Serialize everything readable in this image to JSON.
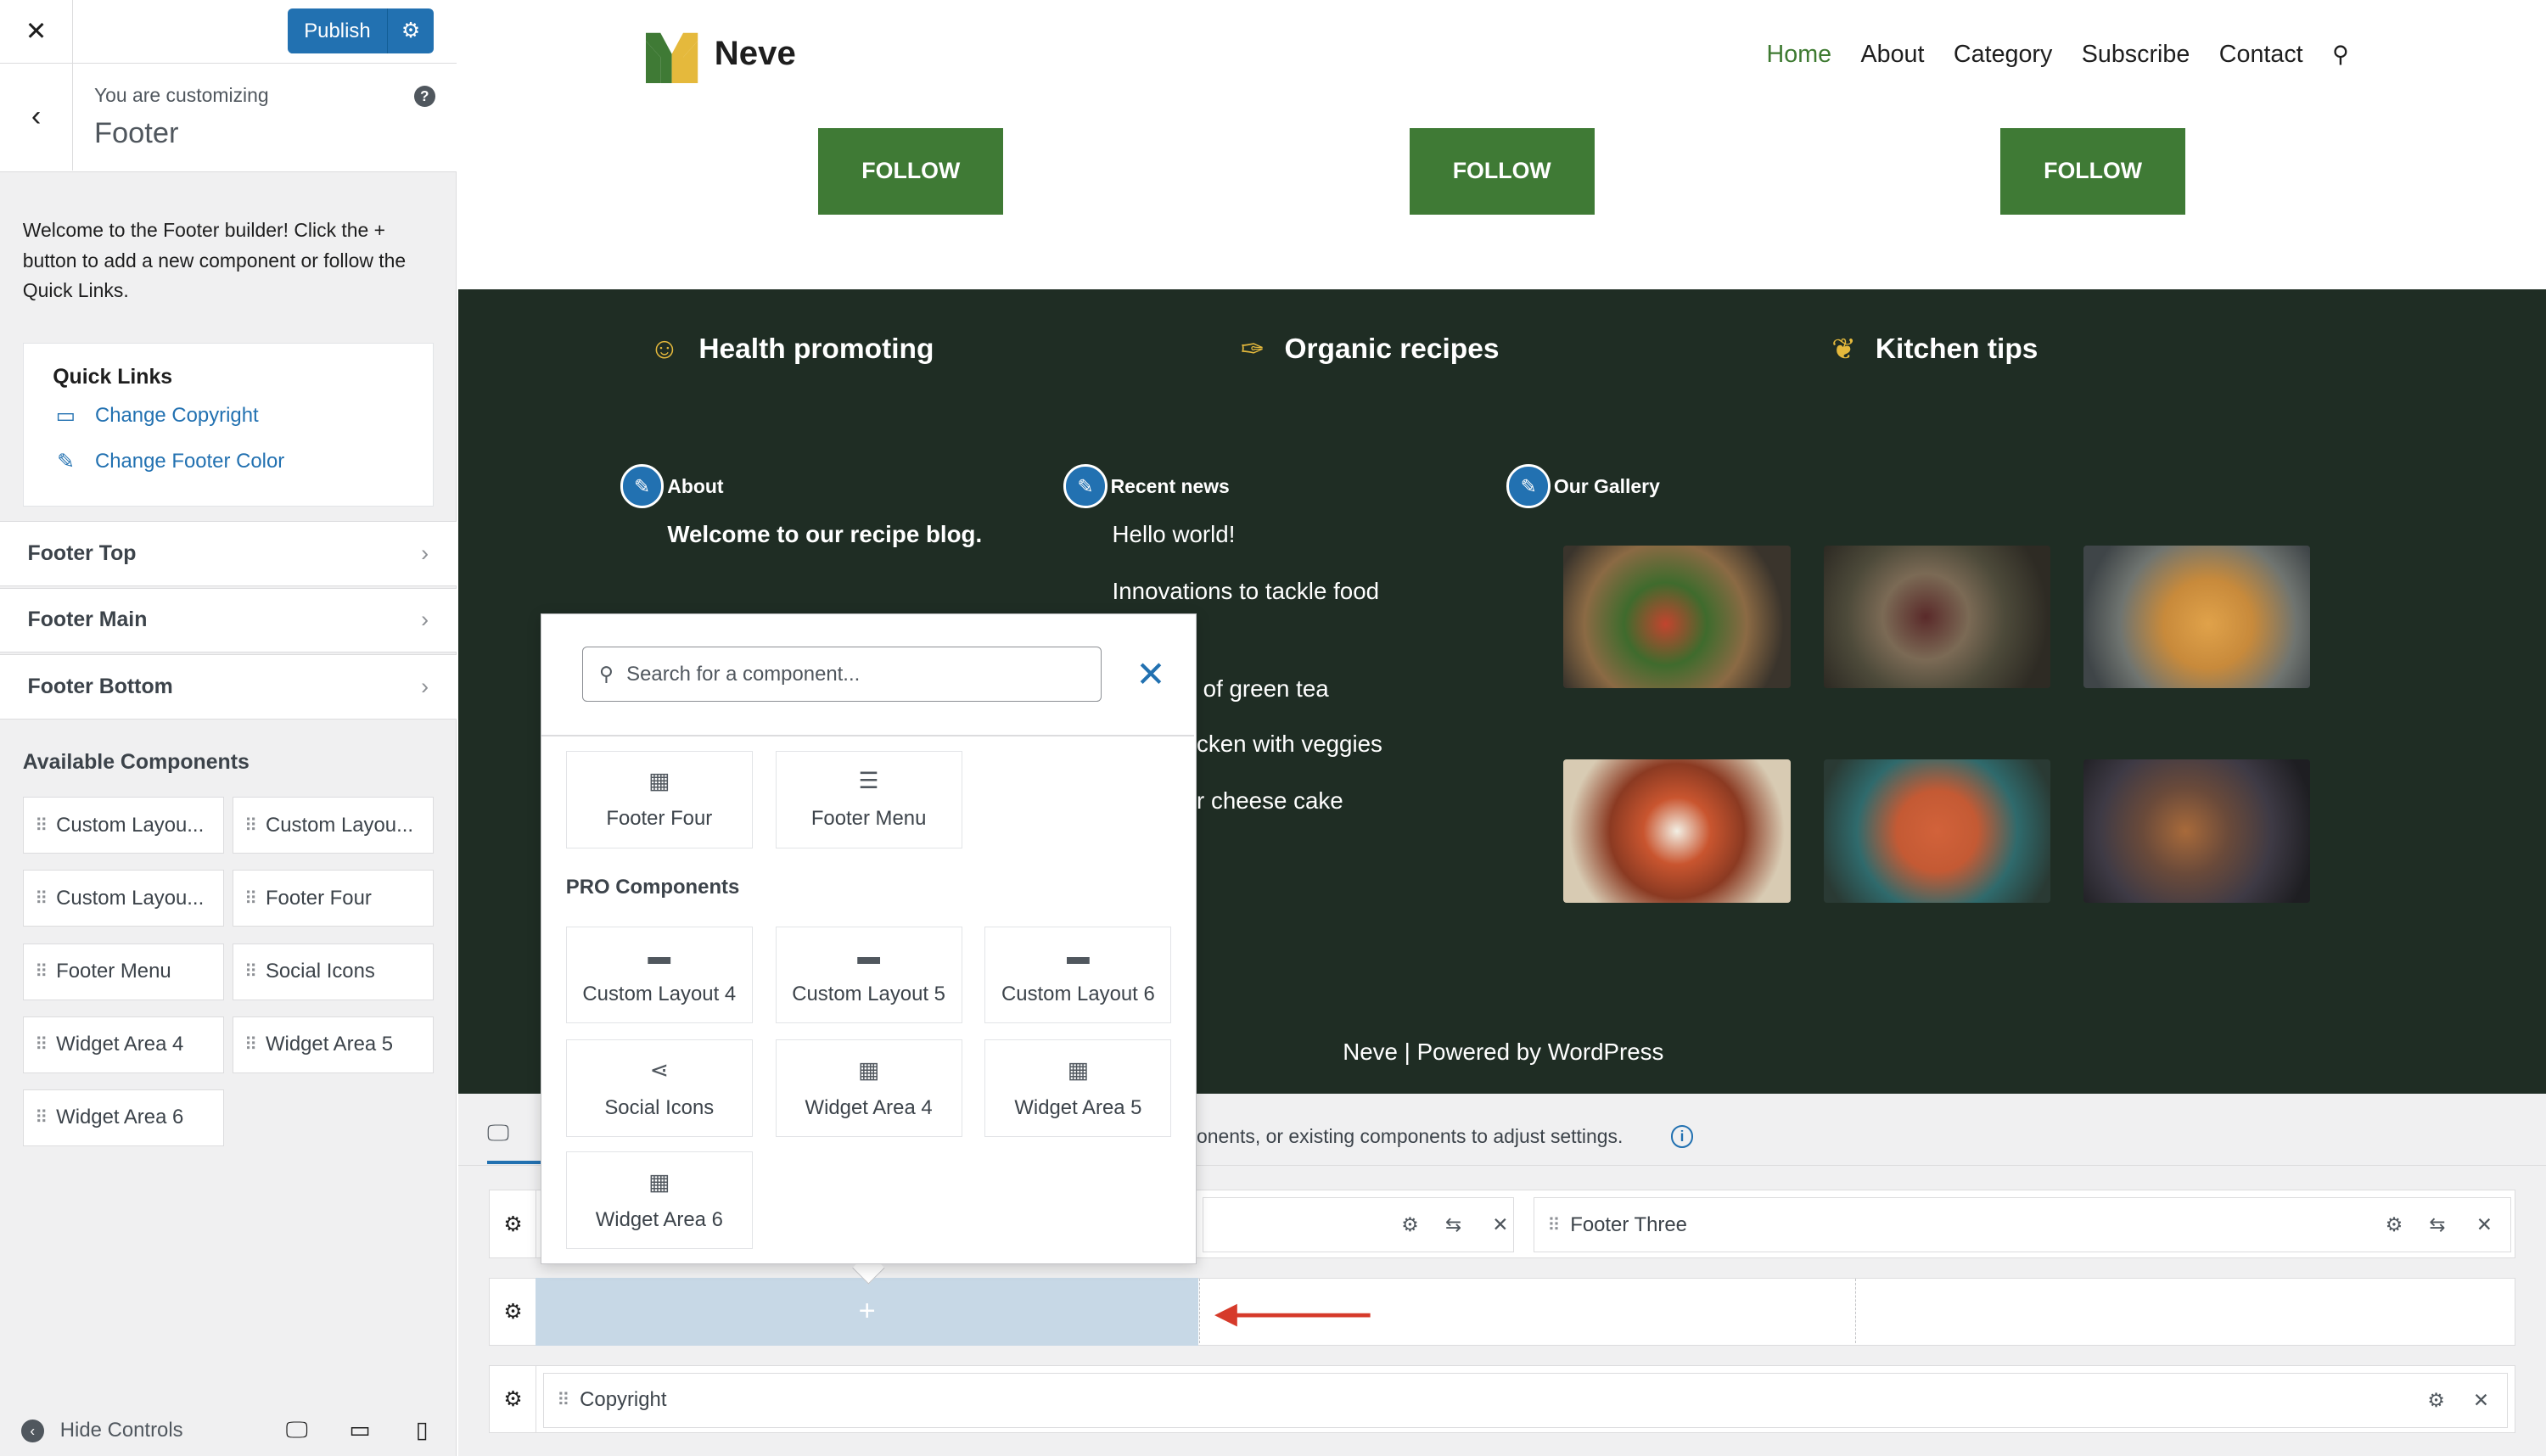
{
  "sidebar": {
    "close_icon": "close-icon",
    "publish_label": "Publish",
    "customizing_label": "You are customizing",
    "customizing_title": "Footer",
    "welcome_text": "Welcome to the Footer builder! Click the + button to add a new component or follow the Quick Links.",
    "quick_links": {
      "title": "Quick Links",
      "items": [
        {
          "label": "Change Copyright",
          "icon": "copyright-icon"
        },
        {
          "label": "Change Footer Color",
          "icon": "paint-brush-icon"
        }
      ]
    },
    "sections": [
      {
        "label": "Footer Top"
      },
      {
        "label": "Footer Main"
      },
      {
        "label": "Footer Bottom"
      }
    ],
    "available_title": "Available Components",
    "components": [
      "Custom Layou...",
      "Custom Layou...",
      "Custom Layou...",
      "Footer Four",
      "Footer Menu",
      "Social Icons",
      "Widget Area 4",
      "Widget Area 5",
      "Widget Area 6"
    ],
    "hide_controls": "Hide Controls"
  },
  "site": {
    "logo_text": "Neve",
    "nav": [
      "Home",
      "About",
      "Category",
      "Subscribe",
      "Contact"
    ],
    "follow_label": "FOLLOW",
    "features": [
      {
        "label": "Health promoting",
        "icon": "smiley-icon"
      },
      {
        "label": "Organic recipes",
        "icon": "carrot-icon"
      },
      {
        "label": "Kitchen tips",
        "icon": "lotus-icon"
      }
    ],
    "widgets": {
      "about_label": "About",
      "about_text": "Welcome to our recipe blog.",
      "news_label": "Recent news",
      "news_items": [
        "Hello world!",
        "Innovations to tackle food",
        "of green tea",
        "cken with veggies",
        "r cheese cake"
      ],
      "gallery_label": "Our Gallery"
    },
    "powered": "Neve | Powered by WordPress",
    "colors": {
      "brand_green": "#3f7a35",
      "footer_bg": "#1f2d24",
      "accent_blue": "#2271b1"
    }
  },
  "builder": {
    "hint": "onents, or existing components to adjust settings.",
    "row_top_slot": "Footer Three",
    "copyright_slot": "Copyright",
    "add_symbol": "+"
  },
  "popup": {
    "search_placeholder": "Search for a component...",
    "basic": [
      {
        "label": "Footer Four",
        "icon": "widget-area-icon"
      },
      {
        "label": "Footer Menu",
        "icon": "menu-icon"
      }
    ],
    "pro_title": "PRO Components",
    "pro": [
      {
        "label": "Custom Layout 4",
        "icon": "layout-icon"
      },
      {
        "label": "Custom Layout 5",
        "icon": "layout-icon"
      },
      {
        "label": "Custom Layout 6",
        "icon": "layout-icon"
      },
      {
        "label": "Social Icons",
        "icon": "share-icon"
      },
      {
        "label": "Widget Area 4",
        "icon": "widget-area-icon"
      },
      {
        "label": "Widget Area 5",
        "icon": "widget-area-icon"
      },
      {
        "label": "Widget Area 6",
        "icon": "widget-area-icon"
      }
    ]
  }
}
